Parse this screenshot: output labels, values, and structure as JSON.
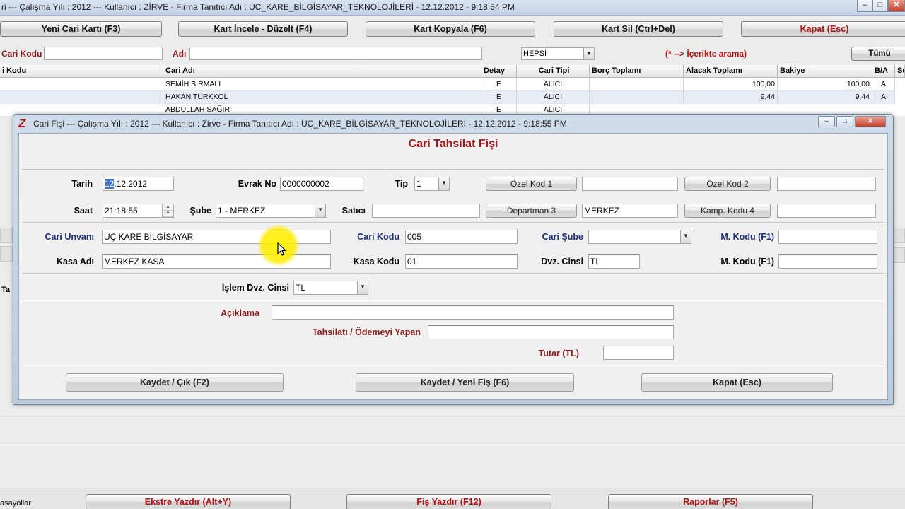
{
  "main_window": {
    "title": "ri  ---  Çalışma Yılı : 2012  ---  Kullanıcı : ZİRVE - Firma Tanıtıcı Adı : UC_KARE_BİLGİSAYAR_TEKNOLOJİLERİ - 12.12.2012 - 9:18:54 PM",
    "controls": {
      "minimize": "–",
      "maximize": "□",
      "close": "✕"
    },
    "toolbar": {
      "new_card": "Yeni Cari Kartı (F3)",
      "inspect_edit": "Kart İncele - Düzelt (F4)",
      "copy_card": "Kart Kopyala (F6)",
      "delete_card": "Kart Sil (Ctrl+Del)",
      "close": "Kapat (Esc)"
    },
    "filter": {
      "code_label": "Cari Kodu",
      "code_value": "",
      "name_label": "Adı",
      "name_value": "",
      "type_value": "HEPSİ",
      "hint": "(* --> İçerikte arama)",
      "all_button": "Tümü"
    },
    "grid": {
      "columns": [
        "i Kodu",
        "Cari Adı",
        "Detay",
        "Cari Tipi",
        "Borç Toplamı",
        "Alacak Toplamı",
        "Bakiye",
        "B/A",
        "Se"
      ],
      "rows": [
        [
          "",
          "SEMİH SIRMALI",
          "E",
          "ALICI",
          "",
          "100,00",
          "100,00",
          "A",
          ""
        ],
        [
          "",
          "HAKAN TÜRKKOL",
          "E",
          "ALICI",
          "",
          "9,44",
          "9,44",
          "A",
          ""
        ],
        [
          "",
          "ABDULLAH SAĞIR",
          "E",
          "ALICI",
          "",
          "",
          "",
          "",
          ""
        ]
      ]
    },
    "side_text": "Ta",
    "bottom_left_text": "asayollar",
    "bottom_buttons": {
      "statement_print": "Ekstre Yazdır (Alt+Y)",
      "slip_print": "Fiş Yazdır (F12)",
      "reports": "Raporlar (F5)"
    }
  },
  "dialog": {
    "title": "Cari Fişi  ---  Çalışma Yılı : 2012  ---  Kullanıcı : Zirve - Firma Tanıtıcı Adı : UC_KARE_BİLGİSAYAR_TEKNOLOJİLERİ - 12.12.2012 - 9:18:55 PM",
    "logo": "Z",
    "heading": "Cari Tahsilat Fişi",
    "date_label": "Tarih",
    "date_selected": "12",
    "date_rest": ".12.2012",
    "doc_no_label": "Evrak No",
    "doc_no_value": "0000000002",
    "type_label": "Tip",
    "type_value": "1",
    "special_code1_button": "Özel Kod 1",
    "special_code1_value": "",
    "special_code2_button": "Özel Kod 2",
    "special_code2_value": "",
    "time_label": "Saat",
    "time_value": "21:18:55",
    "branch_label": "Şube",
    "branch_value": "1 - MERKEZ",
    "seller_label": "Satıcı",
    "seller_value": "",
    "department_button": "Departman 3",
    "department_value": "MERKEZ",
    "campaign_button": "Kamp. Kodu 4",
    "campaign_value": "",
    "account_title_label": "Cari Unvanı",
    "account_title_value": "ÜÇ KARE BİLGİSAYAR",
    "account_code_label": "Cari Kodu",
    "account_code_value": "005",
    "account_branch_label": "Cari Şube",
    "account_branch_value": "",
    "m_code1_label": "M. Kodu (F1)",
    "m_code1_value": "",
    "cash_name_label": "Kasa Adı",
    "cash_name_value": "MERKEZ KASA",
    "cash_code_label": "Kasa Kodu",
    "cash_code_value": "01",
    "currency_label": "Dvz. Cinsi",
    "currency_value": "TL",
    "m_code2_label": "M. Kodu (F1)",
    "m_code2_value": "",
    "txn_currency_label": "İşlem Dvz. Cinsi",
    "txn_currency_value": "TL",
    "description_label": "Açıklama",
    "description_value": "",
    "payer_label": "Tahsilatı / Ödemeyi Yapan",
    "payer_value": "",
    "amount_label": "Tutar (TL)",
    "amount_value": "",
    "save_exit": "Kaydet / Çık (F2)",
    "save_new": "Kaydet / Yeni Fiş (F6)",
    "close": "Kapat (Esc)"
  },
  "colors": {
    "heading_red": "#a3141b",
    "label_navy": "#1c2f7a",
    "label_darkred": "#8b1a1a",
    "cursor_highlight": "#ffec00"
  }
}
